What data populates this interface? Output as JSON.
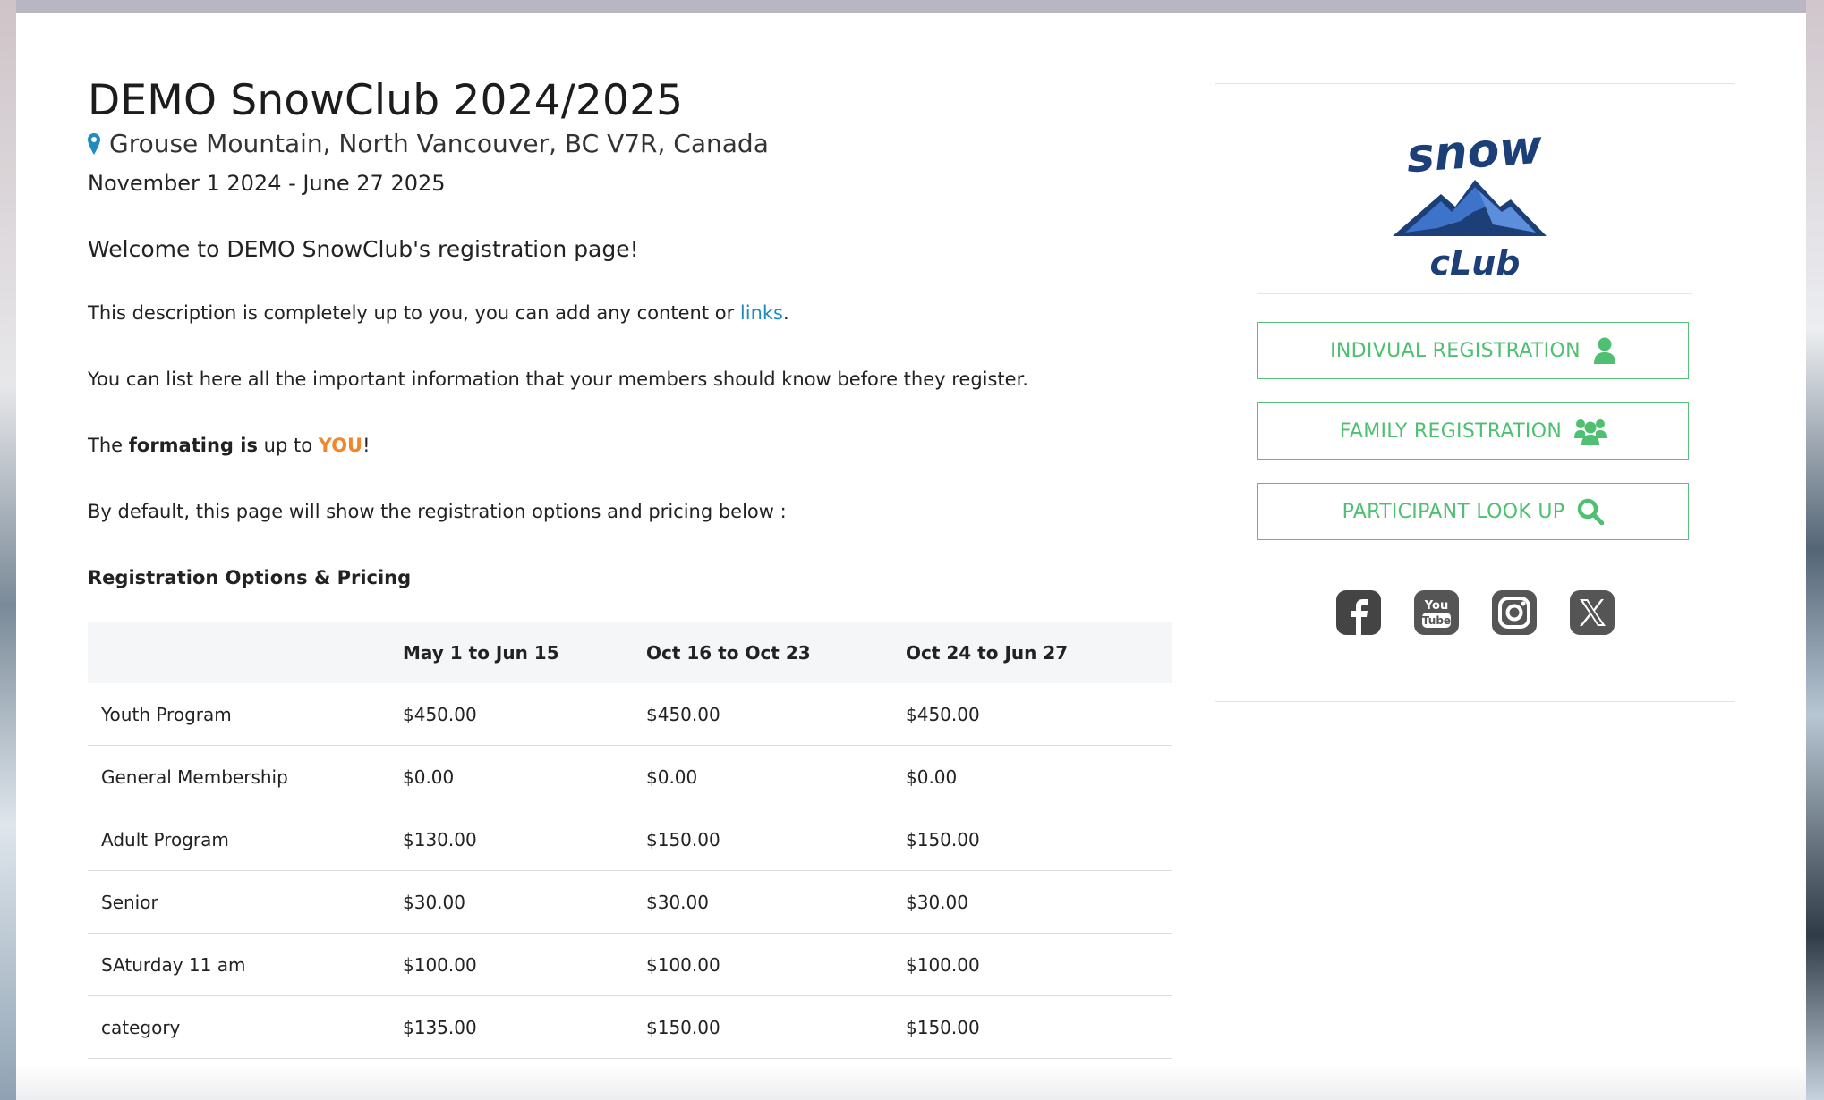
{
  "event": {
    "title": "DEMO SnowClub 2024/2025",
    "location": "Grouse Mountain, North Vancouver, BC V7R, Canada",
    "dates": "November 1 2024 - June 27 2025"
  },
  "description": {
    "welcome": "Welcome to DEMO SnowClub's registration page!",
    "p1_before": "This description is completely up to you, you can add any content or",
    "p1_link": "links",
    "p1_after": ".",
    "p2": "You can list here all the important information that your members should know before they register.",
    "p3_the": "The",
    "p3_bold": "formating is",
    "p3_mid": "up to",
    "p3_you": "YOU",
    "p3_end": "!",
    "p4": "By default, this page will show the registration options and pricing below :"
  },
  "pricing": {
    "title": "Registration Options & Pricing",
    "headers": [
      "",
      "May 1 to Jun 15",
      "Oct 16 to Oct 23",
      "Oct 24 to Jun 27"
    ],
    "rows": [
      [
        "Youth Program",
        "$450.00",
        "$450.00",
        "$450.00"
      ],
      [
        "General Membership",
        "$0.00",
        "$0.00",
        "$0.00"
      ],
      [
        "Adult Program",
        "$130.00",
        "$150.00",
        "$150.00"
      ],
      [
        "Senior",
        "$30.00",
        "$30.00",
        "$30.00"
      ],
      [
        "SAturday 11 am",
        "$100.00",
        "$100.00",
        "$100.00"
      ],
      [
        "category",
        "$135.00",
        "$150.00",
        "$150.00"
      ]
    ]
  },
  "sidebar": {
    "logo_top": "snow",
    "logo_bottom": "cLub",
    "buttons": {
      "individual": "INDIVUAL REGISTRATION",
      "family": "FAMILY REGISTRATION",
      "lookup": "PARTICIPANT LOOK UP"
    },
    "social_icons": [
      "facebook-icon",
      "youtube-icon",
      "instagram-icon",
      "x-icon"
    ]
  },
  "colors": {
    "accent_green": "#4fbf72",
    "link_blue": "#1f8bc0",
    "highlight_orange": "#f0872a",
    "logo_navy": "#1d3f78"
  }
}
